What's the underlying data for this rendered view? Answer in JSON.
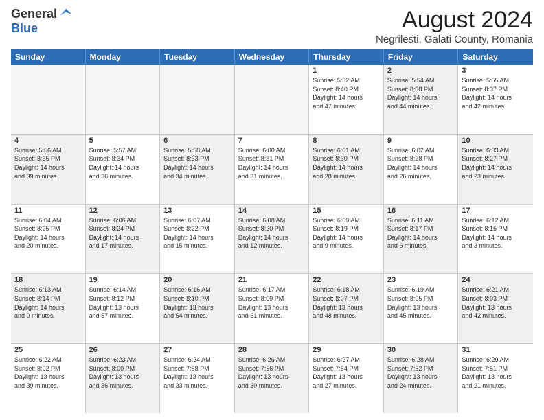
{
  "logo": {
    "general": "General",
    "blue": "Blue"
  },
  "title": "August 2024",
  "location": "Negrilesti, Galati County, Romania",
  "header_days": [
    "Sunday",
    "Monday",
    "Tuesday",
    "Wednesday",
    "Thursday",
    "Friday",
    "Saturday"
  ],
  "weeks": [
    [
      {
        "day": "",
        "text": "",
        "empty": true
      },
      {
        "day": "",
        "text": "",
        "empty": true
      },
      {
        "day": "",
        "text": "",
        "empty": true
      },
      {
        "day": "",
        "text": "",
        "empty": true
      },
      {
        "day": "1",
        "text": "Sunrise: 5:52 AM\nSunset: 8:40 PM\nDaylight: 14 hours\nand 47 minutes."
      },
      {
        "day": "2",
        "text": "Sunrise: 5:54 AM\nSunset: 8:38 PM\nDaylight: 14 hours\nand 44 minutes.",
        "shaded": true
      },
      {
        "day": "3",
        "text": "Sunrise: 5:55 AM\nSunset: 8:37 PM\nDaylight: 14 hours\nand 42 minutes."
      }
    ],
    [
      {
        "day": "4",
        "text": "Sunrise: 5:56 AM\nSunset: 8:35 PM\nDaylight: 14 hours\nand 39 minutes.",
        "shaded": true
      },
      {
        "day": "5",
        "text": "Sunrise: 5:57 AM\nSunset: 8:34 PM\nDaylight: 14 hours\nand 36 minutes."
      },
      {
        "day": "6",
        "text": "Sunrise: 5:58 AM\nSunset: 8:33 PM\nDaylight: 14 hours\nand 34 minutes.",
        "shaded": true
      },
      {
        "day": "7",
        "text": "Sunrise: 6:00 AM\nSunset: 8:31 PM\nDaylight: 14 hours\nand 31 minutes."
      },
      {
        "day": "8",
        "text": "Sunrise: 6:01 AM\nSunset: 8:30 PM\nDaylight: 14 hours\nand 28 minutes.",
        "shaded": true
      },
      {
        "day": "9",
        "text": "Sunrise: 6:02 AM\nSunset: 8:28 PM\nDaylight: 14 hours\nand 26 minutes."
      },
      {
        "day": "10",
        "text": "Sunrise: 6:03 AM\nSunset: 8:27 PM\nDaylight: 14 hours\nand 23 minutes.",
        "shaded": true
      }
    ],
    [
      {
        "day": "11",
        "text": "Sunrise: 6:04 AM\nSunset: 8:25 PM\nDaylight: 14 hours\nand 20 minutes."
      },
      {
        "day": "12",
        "text": "Sunrise: 6:06 AM\nSunset: 8:24 PM\nDaylight: 14 hours\nand 17 minutes.",
        "shaded": true
      },
      {
        "day": "13",
        "text": "Sunrise: 6:07 AM\nSunset: 8:22 PM\nDaylight: 14 hours\nand 15 minutes."
      },
      {
        "day": "14",
        "text": "Sunrise: 6:08 AM\nSunset: 8:20 PM\nDaylight: 14 hours\nand 12 minutes.",
        "shaded": true
      },
      {
        "day": "15",
        "text": "Sunrise: 6:09 AM\nSunset: 8:19 PM\nDaylight: 14 hours\nand 9 minutes."
      },
      {
        "day": "16",
        "text": "Sunrise: 6:11 AM\nSunset: 8:17 PM\nDaylight: 14 hours\nand 6 minutes.",
        "shaded": true
      },
      {
        "day": "17",
        "text": "Sunrise: 6:12 AM\nSunset: 8:15 PM\nDaylight: 14 hours\nand 3 minutes."
      }
    ],
    [
      {
        "day": "18",
        "text": "Sunrise: 6:13 AM\nSunset: 8:14 PM\nDaylight: 14 hours\nand 0 minutes.",
        "shaded": true
      },
      {
        "day": "19",
        "text": "Sunrise: 6:14 AM\nSunset: 8:12 PM\nDaylight: 13 hours\nand 57 minutes."
      },
      {
        "day": "20",
        "text": "Sunrise: 6:16 AM\nSunset: 8:10 PM\nDaylight: 13 hours\nand 54 minutes.",
        "shaded": true
      },
      {
        "day": "21",
        "text": "Sunrise: 6:17 AM\nSunset: 8:09 PM\nDaylight: 13 hours\nand 51 minutes."
      },
      {
        "day": "22",
        "text": "Sunrise: 6:18 AM\nSunset: 8:07 PM\nDaylight: 13 hours\nand 48 minutes.",
        "shaded": true
      },
      {
        "day": "23",
        "text": "Sunrise: 6:19 AM\nSunset: 8:05 PM\nDaylight: 13 hours\nand 45 minutes."
      },
      {
        "day": "24",
        "text": "Sunrise: 6:21 AM\nSunset: 8:03 PM\nDaylight: 13 hours\nand 42 minutes.",
        "shaded": true
      }
    ],
    [
      {
        "day": "25",
        "text": "Sunrise: 6:22 AM\nSunset: 8:02 PM\nDaylight: 13 hours\nand 39 minutes."
      },
      {
        "day": "26",
        "text": "Sunrise: 6:23 AM\nSunset: 8:00 PM\nDaylight: 13 hours\nand 36 minutes.",
        "shaded": true
      },
      {
        "day": "27",
        "text": "Sunrise: 6:24 AM\nSunset: 7:58 PM\nDaylight: 13 hours\nand 33 minutes."
      },
      {
        "day": "28",
        "text": "Sunrise: 6:26 AM\nSunset: 7:56 PM\nDaylight: 13 hours\nand 30 minutes.",
        "shaded": true
      },
      {
        "day": "29",
        "text": "Sunrise: 6:27 AM\nSunset: 7:54 PM\nDaylight: 13 hours\nand 27 minutes."
      },
      {
        "day": "30",
        "text": "Sunrise: 6:28 AM\nSunset: 7:52 PM\nDaylight: 13 hours\nand 24 minutes.",
        "shaded": true
      },
      {
        "day": "31",
        "text": "Sunrise: 6:29 AM\nSunset: 7:51 PM\nDaylight: 13 hours\nand 21 minutes."
      }
    ]
  ]
}
